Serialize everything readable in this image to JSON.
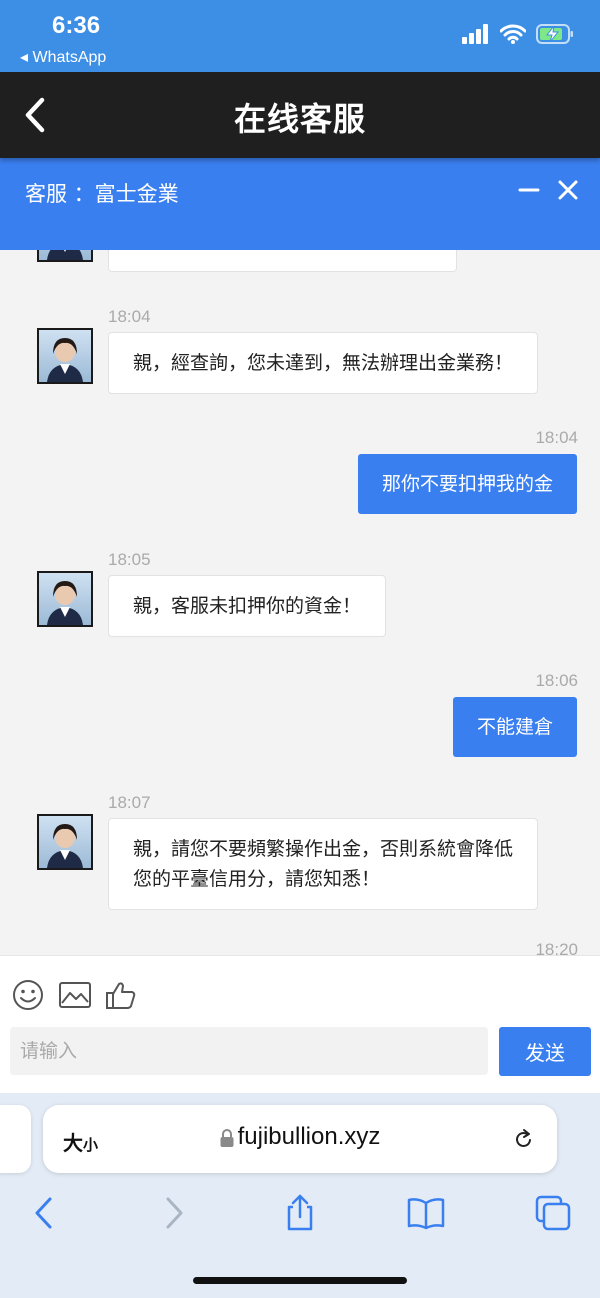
{
  "status": {
    "time": "6:36",
    "back_app": "◂ WhatsApp"
  },
  "app": {
    "title": "在线客服"
  },
  "service": {
    "title": "客服 ：富士金業"
  },
  "messages": [
    {
      "from": "agent",
      "time": "18:04",
      "text": "親，經查詢，您未達到，無法辦理出金業務！"
    },
    {
      "from": "user",
      "time": "18:04",
      "text": "那你不要扣押我的金"
    },
    {
      "from": "agent",
      "time": "18:05",
      "text": "親，客服未扣押你的資金！"
    },
    {
      "from": "user",
      "time": "18:06",
      "text": "不能建倉"
    },
    {
      "from": "agent",
      "time": "18:07",
      "lines": [
        "親，請您不要頻繁操作出金，否則系統會降低",
        "您的平臺信用分，請您知悉！"
      ]
    },
    {
      "from": "user",
      "time": "18:20"
    }
  ],
  "composer": {
    "placeholder": "请输入",
    "send_label": "发送",
    "tools": [
      "smile-icon",
      "image-icon",
      "thumbs-up-icon"
    ]
  },
  "browser": {
    "text_size_big": "大",
    "text_size_small": "小",
    "url": "fujibullion.xyz"
  },
  "colors": {
    "status_bar": "#3d8fe6",
    "app_bar": "#1f1f1f",
    "service_bar": "#3a7ff0",
    "user_bubble": "#3a7ff0",
    "chat_bg": "#f3f3f4"
  }
}
